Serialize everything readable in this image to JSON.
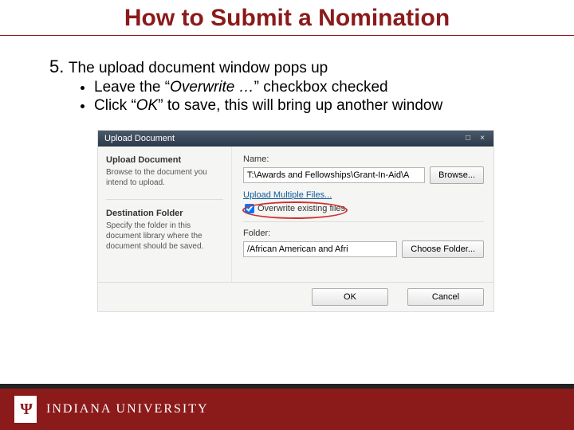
{
  "slide": {
    "title": "How to Submit a Nomination",
    "step_number": "5.",
    "step_text": "The upload document window pops up",
    "bullets": [
      {
        "pre": "Leave the “",
        "em": "Overwrite …",
        "post": "” checkbox checked"
      },
      {
        "pre": "Click “",
        "em": "OK",
        "post": "” to save, this will bring up another window"
      }
    ]
  },
  "dialog": {
    "title": "Upload Document",
    "sidebar": {
      "h1": "Upload Document",
      "p1": "Browse to the document you intend to upload.",
      "h2": "Destination Folder",
      "p2": "Specify the folder in this document library where the document should be saved."
    },
    "main": {
      "name_label": "Name:",
      "name_value": "T:\\Awards and Fellowships\\Grant-In-Aid\\A",
      "browse_label": "Browse...",
      "multi_link": "Upload Multiple Files...",
      "overwrite_label": "Overwrite existing files",
      "folder_label": "Folder:",
      "folder_value": "/African American and Afri",
      "choose_folder_label": "Choose Folder..."
    },
    "buttons": {
      "ok": "OK",
      "cancel": "Cancel"
    }
  },
  "footer": {
    "logo_letters": "Ψ",
    "university": "INDIANA UNIVERSITY"
  }
}
